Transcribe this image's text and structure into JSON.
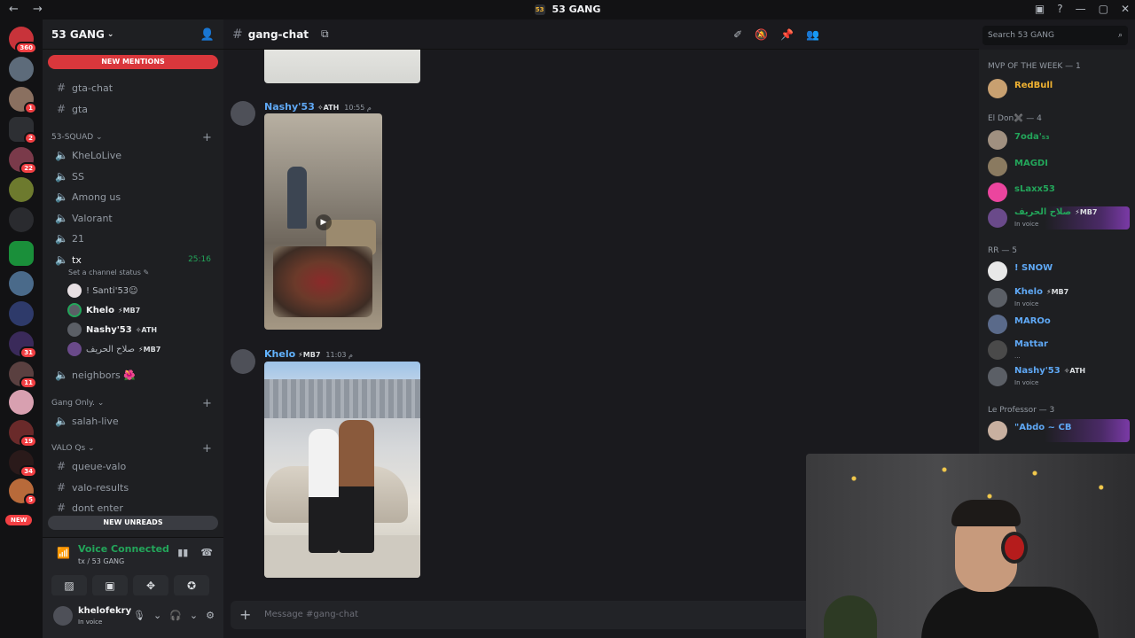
{
  "window": {
    "title": "53 GANG",
    "nav": "← →",
    "controls": [
      "▣",
      "?",
      "—",
      "▢",
      "✕"
    ]
  },
  "rail": {
    "servers": [
      {
        "badge": "360"
      },
      {
        "badge": ""
      },
      {
        "badge": "1"
      },
      {
        "badge": "2"
      },
      {
        "badge": "22"
      },
      {
        "badge": ""
      },
      {
        "badge": ""
      },
      {
        "badge": ""
      },
      {
        "badge": ""
      },
      {
        "badge": "31"
      },
      {
        "badge": "11"
      },
      {
        "badge": ""
      },
      {
        "badge": "19"
      },
      {
        "badge": "34"
      },
      {
        "badge": "5"
      }
    ],
    "new_label": "NEW"
  },
  "sidebar": {
    "server_name": "53 GANG",
    "new_mentions": "NEW MENTIONS",
    "new_unreads": "NEW UNREADS",
    "channels_top": [
      {
        "name": "gta-chat",
        "icon": "#"
      },
      {
        "name": "gta",
        "icon": "#"
      }
    ],
    "category_squad": "53-SQUAD",
    "squad_channels": [
      {
        "name": "KheLoLive"
      },
      {
        "name": "SS"
      },
      {
        "name": "Among us"
      },
      {
        "name": "Valorant"
      },
      {
        "name": "21"
      }
    ],
    "tx": {
      "name": "tx",
      "time": "25:16",
      "status": "Set a channel status ✎"
    },
    "voice_users": [
      {
        "name": "! Santi'53☺",
        "tag": ""
      },
      {
        "name": "Khelo",
        "tag": "⚡MB7"
      },
      {
        "name": "Nashy'53",
        "tag": "✧ATH"
      },
      {
        "name": "صلاح الحريف",
        "tag": "⚡MB7"
      }
    ],
    "neighbors": "neighbors 🌺",
    "category_gang": "Gang Only.",
    "salah_live": "salah-live",
    "category_valo": "VALO Qs",
    "valo_channels": [
      {
        "name": "queue-valo"
      },
      {
        "name": "valo-results"
      },
      {
        "name": "dont enter"
      }
    ],
    "voice": {
      "title": "Voice Connected",
      "sub": "tx / 53 GANG"
    },
    "user": {
      "name": "khelofekry",
      "status": "In voice"
    }
  },
  "chat": {
    "channel": "gang-chat",
    "search_placeholder": "Search 53 GANG",
    "messages": [
      {
        "author": "Nashy'53",
        "tag": "✧ATH",
        "time": "10:55 م"
      },
      {
        "author": "Khelo",
        "tag": "⚡MB7",
        "time": "11:03 م"
      }
    ],
    "composer_placeholder": "Message #gang-chat"
  },
  "members": {
    "groups": [
      {
        "title": "MVP OF THE WEEK — 1",
        "members": [
          {
            "name": "RedBull",
            "color": "#f0b232"
          }
        ]
      },
      {
        "title": "El Don✖️ — 4",
        "members": [
          {
            "name": "7oda'₅₃",
            "color": "#23a55a"
          },
          {
            "name": "MAGDI",
            "color": "#23a55a"
          },
          {
            "name": "sLaxx53",
            "color": "#23a55a"
          },
          {
            "name": "صلاح الحريف",
            "color": "#23a55a",
            "tag": "⚡MB7",
            "sub": "In voice"
          }
        ]
      },
      {
        "title": "RR — 5",
        "members": [
          {
            "name": "! SNOW",
            "color": "#5fa8f5"
          },
          {
            "name": "Khelo",
            "color": "#5fa8f5",
            "tag": "⚡MB7",
            "sub": "In voice"
          },
          {
            "name": "MAROo",
            "color": "#5fa8f5"
          },
          {
            "name": "Mattar",
            "color": "#5fa8f5",
            "sub": "..."
          },
          {
            "name": "Nashy'53",
            "color": "#5fa8f5",
            "tag": "✧ATH",
            "sub": "In voice"
          }
        ]
      },
      {
        "title": "Le Professor — 3",
        "members": [
          {
            "name": "\"Abdo ~ CB",
            "color": "#5fa8f5"
          }
        ]
      }
    ]
  }
}
